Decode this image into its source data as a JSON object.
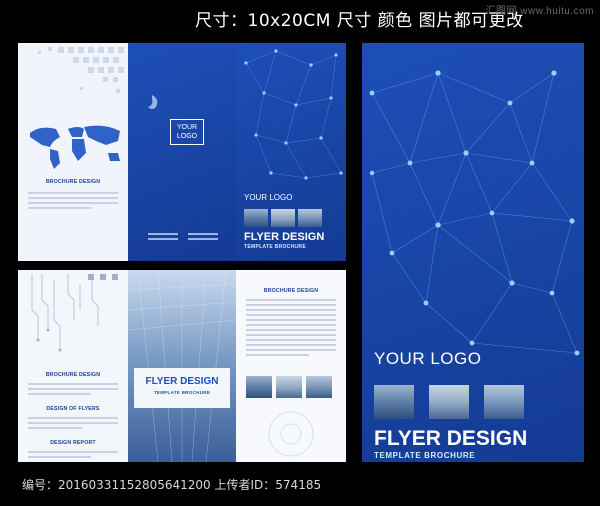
{
  "header_note": "尺寸：10x20CM   尺寸 颜色 图片都可更改",
  "watermark": "汇图网 www.huitu.com",
  "footer_note": "编号：20160331152805641200 上传者ID：574185",
  "brochure": {
    "logo_text": "YOUR LOGO",
    "logo_box_line1": "YOUR",
    "logo_box_line2": "LOGO",
    "flyer_title": "FLYER DESIGN",
    "flyer_subtitle": "TEMPLATE BROCHURE",
    "brochure_design": "BROCHURE DESIGN",
    "design_of_flyers": "DESIGN OF FLYERS",
    "design_report": "DESIGN REPORT"
  },
  "colors": {
    "brand_blue": "#1d4fb8",
    "dot_color": "#8fd3ff"
  }
}
